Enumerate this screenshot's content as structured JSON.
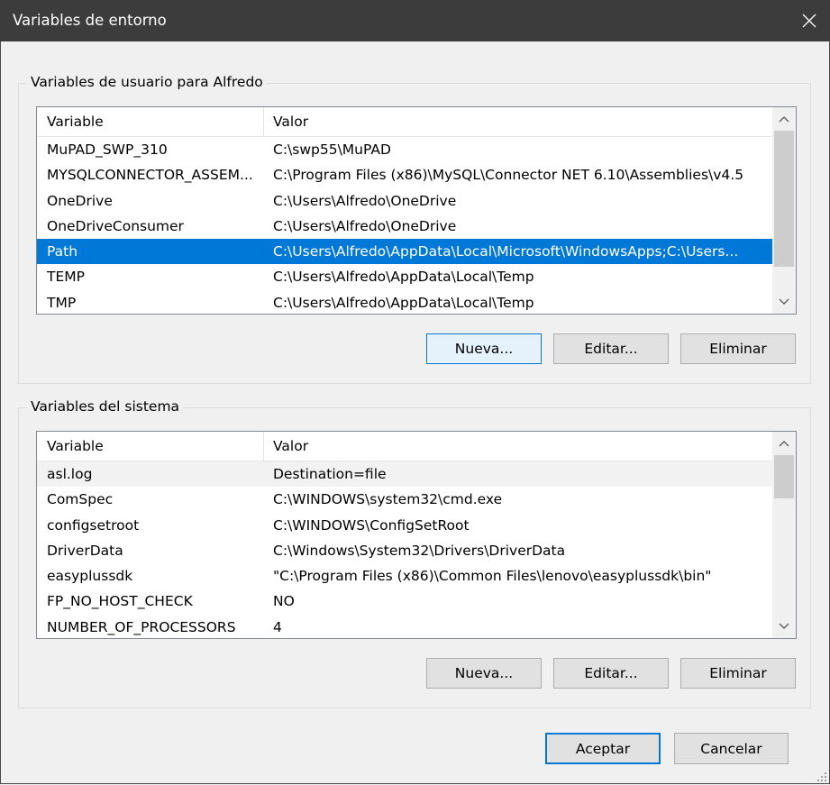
{
  "window": {
    "title": "Variables de entorno"
  },
  "user_section": {
    "legend": "Variables de usuario para Alfredo",
    "columns": [
      "Variable",
      "Valor"
    ],
    "rows": [
      {
        "variable": "MuPAD_SWP_310",
        "value": "C:\\swp55\\MuPAD"
      },
      {
        "variable": "MYSQLCONNECTOR_ASSEM...",
        "value": "C:\\Program Files (x86)\\MySQL\\Connector NET 6.10\\Assemblies\\v4.5"
      },
      {
        "variable": "OneDrive",
        "value": "C:\\Users\\Alfredo\\OneDrive"
      },
      {
        "variable": "OneDriveConsumer",
        "value": "C:\\Users\\Alfredo\\OneDrive"
      },
      {
        "variable": "Path",
        "value": "C:\\Users\\Alfredo\\AppData\\Local\\Microsoft\\WindowsApps;C:\\Users...",
        "selected": true
      },
      {
        "variable": "TEMP",
        "value": "C:\\Users\\Alfredo\\AppData\\Local\\Temp"
      },
      {
        "variable": "TMP",
        "value": "C:\\Users\\Alfredo\\AppData\\Local\\Temp"
      }
    ],
    "buttons": {
      "new": "Nueva...",
      "edit": "Editar...",
      "delete": "Eliminar"
    }
  },
  "system_section": {
    "legend": "Variables del sistema",
    "columns": [
      "Variable",
      "Valor"
    ],
    "rows": [
      {
        "variable": "asl.log",
        "value": "Destination=file",
        "shaded": true
      },
      {
        "variable": "ComSpec",
        "value": "C:\\WINDOWS\\system32\\cmd.exe"
      },
      {
        "variable": "configsetroot",
        "value": "C:\\WINDOWS\\ConfigSetRoot"
      },
      {
        "variable": "DriverData",
        "value": "C:\\Windows\\System32\\Drivers\\DriverData"
      },
      {
        "variable": "easyplussdk",
        "value": "\"C:\\Program Files (x86)\\Common Files\\lenovo\\easyplussdk\\bin\""
      },
      {
        "variable": "FP_NO_HOST_CHECK",
        "value": "NO"
      },
      {
        "variable": "NUMBER_OF_PROCESSORS",
        "value": "4"
      }
    ],
    "buttons": {
      "new": "Nueva...",
      "edit": "Editar...",
      "delete": "Eliminar"
    }
  },
  "footer": {
    "ok": "Aceptar",
    "cancel": "Cancelar"
  },
  "colors": {
    "titlebar": "#3c3c3c",
    "selection": "#0078d7",
    "dialog_bg": "#f0f0f0"
  },
  "icons": [
    "close-icon",
    "chevron-up-icon",
    "chevron-down-icon",
    "resize-grip-icon"
  ]
}
